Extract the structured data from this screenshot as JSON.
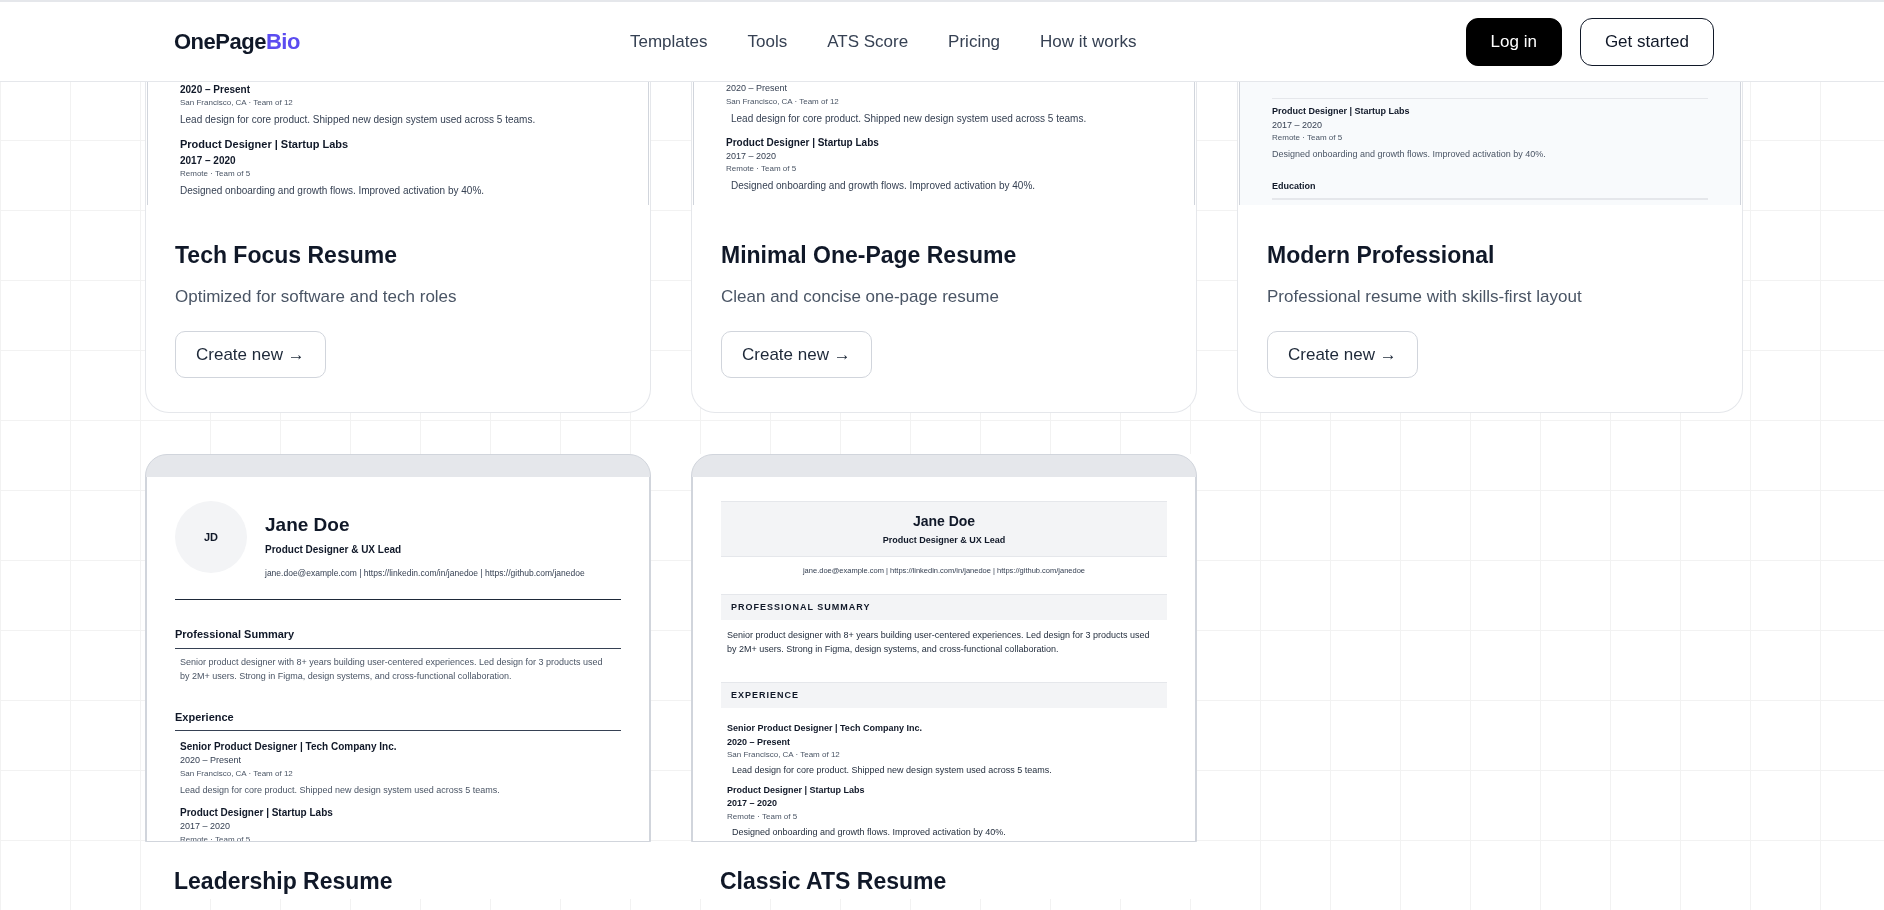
{
  "header": {
    "brand": {
      "main": "OnePage",
      "accent": "Bio"
    },
    "nav": [
      "Templates",
      "Tools",
      "ATS Score",
      "Pricing",
      "How it works"
    ],
    "actions": [
      {
        "label": "Log in",
        "kind": "primary"
      },
      {
        "label": "Get started",
        "kind": "outline"
      }
    ]
  },
  "cards": [
    {
      "title": "Tech Focus Resume",
      "description": "Optimized for software and tech roles",
      "button": "Create new →",
      "preview": {
        "kind": "tech",
        "sections": [
          {
            "lines": [
              {
                "kind": "date",
                "text": "2020 – Present"
              },
              {
                "kind": "meta",
                "text": "San Francisco, CA · Team of 12"
              },
              {
                "kind": "desc",
                "text": "Lead design for core product. Shipped new design system used across 5 teams."
              },
              {
                "kind": "role",
                "text": "Product Designer | Startup Labs"
              },
              {
                "kind": "date",
                "text": "2017 – 2020"
              },
              {
                "kind": "meta",
                "text": "Remote · Team of 5"
              },
              {
                "kind": "desc",
                "text": "Designed onboarding and growth flows. Improved activation by 40%."
              }
            ]
          }
        ]
      }
    },
    {
      "title": "Minimal One-Page Resume",
      "description": "Clean and concise one-page resume",
      "button": "Create new →",
      "preview": {
        "kind": "minimal",
        "sections": [
          {
            "lines": [
              {
                "kind": "date",
                "text": "2020 – Present"
              },
              {
                "kind": "meta",
                "text": "San Francisco, CA · Team of 12"
              },
              {
                "kind": "desc",
                "text": "Lead design for core product. Shipped new design system used across 5 teams."
              },
              {
                "kind": "role",
                "text": "Product Designer | Startup Labs"
              },
              {
                "kind": "date",
                "text": "2017 – 2020"
              },
              {
                "kind": "meta",
                "text": "Remote · Team of 5"
              },
              {
                "kind": "desc",
                "text": "Designed onboarding and growth flows. Improved activation by 40%."
              }
            ]
          }
        ]
      }
    },
    {
      "title": "Modern Professional",
      "description": "Professional resume with skills-first layout",
      "button": "Create new →",
      "preview": {
        "kind": "modern",
        "sections": [
          {
            "lines": [
              {
                "kind": "role",
                "text": "Product Designer | Startup Labs"
              },
              {
                "kind": "date",
                "text": "2017 – 2020"
              },
              {
                "kind": "meta",
                "text": "Remote · Team of 5"
              },
              {
                "kind": "desc",
                "text": "Designed onboarding and growth flows. Improved activation by 40%."
              }
            ]
          },
          {
            "heading": "Education"
          }
        ]
      }
    },
    {
      "title": "Leadership Resume",
      "preview": {
        "kind": "leadership",
        "initials": "JD",
        "name": "Jane Doe",
        "role": "Product Designer & UX Lead",
        "contact": "jane.doe@example.com | https://linkedin.com/in/janedoe | https://github.com/janedoe",
        "sections": [
          {
            "heading": "Professional Summary",
            "lines": [
              {
                "kind": "para",
                "text": "Senior product designer with 8+ years building user-centered experiences. Led design for 3 products used by 2M+ users. Strong in Figma, design systems, and cross-functional collaboration."
              }
            ]
          },
          {
            "heading": "Experience",
            "lines": [
              {
                "kind": "role",
                "text": "Senior Product Designer | Tech Company Inc."
              },
              {
                "kind": "date",
                "text": "2020 – Present"
              },
              {
                "kind": "meta",
                "text": "San Francisco, CA · Team of 12"
              },
              {
                "kind": "desc",
                "text": "Lead design for core product. Shipped new design system used across 5 teams."
              },
              {
                "kind": "role",
                "text": "Product Designer | Startup Labs"
              },
              {
                "kind": "date",
                "text": "2017 – 2020"
              },
              {
                "kind": "meta",
                "text": "Remote · Team of 5"
              }
            ]
          }
        ]
      }
    },
    {
      "title": "Classic ATS Resume",
      "preview": {
        "kind": "classic",
        "name": "Jane Doe",
        "role": "Product Designer & UX Lead",
        "contact": "jane.doe@example.com | https://linkedin.com/in/janedoe | https://github.com/janedoe",
        "sections": [
          {
            "heading": "PROFESSIONAL SUMMARY",
            "lines": [
              {
                "kind": "para",
                "text": "Senior product designer with 8+ years building user-centered experiences. Led design for 3 products used by 2M+ users. Strong in Figma, design systems, and cross-functional collaboration."
              }
            ]
          },
          {
            "heading": "EXPERIENCE",
            "lines": [
              {
                "kind": "role",
                "text": "Senior Product Designer | Tech Company Inc."
              },
              {
                "kind": "date",
                "text": "2020 – Present"
              },
              {
                "kind": "meta",
                "text": "San Francisco, CA · Team of 12"
              },
              {
                "kind": "desc",
                "text": "Lead design for core product. Shipped new design system used across 5 teams."
              },
              {
                "kind": "role",
                "text": "Product Designer | Startup Labs"
              },
              {
                "kind": "date",
                "text": "2017 – 2020"
              },
              {
                "kind": "meta",
                "text": "Remote · Team of 5"
              },
              {
                "kind": "desc",
                "text": "Designed onboarding and growth flows. Improved activation by 40%."
              }
            ]
          }
        ]
      }
    }
  ]
}
